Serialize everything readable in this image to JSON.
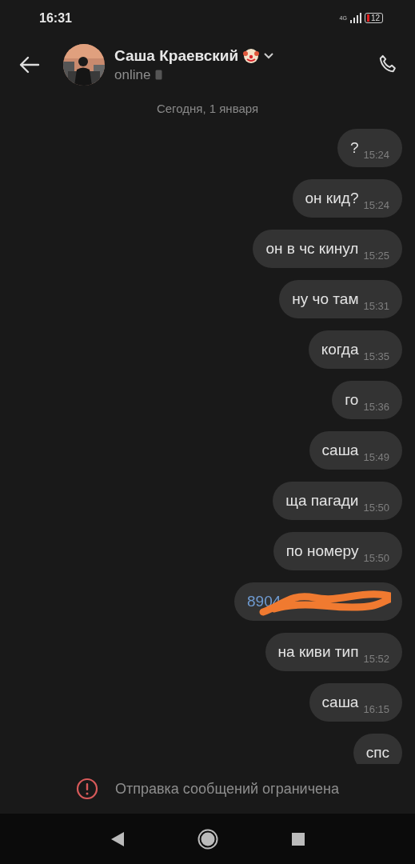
{
  "status_bar": {
    "time": "16:31",
    "network": "4G",
    "battery": "12"
  },
  "header": {
    "contact_name": "Саша Краевский",
    "presence": "online"
  },
  "date_divider": "Сегодня, 1 января",
  "messages": [
    {
      "kind": "text",
      "text": "?",
      "time": "15:24"
    },
    {
      "kind": "text",
      "text": "он кид?",
      "time": "15:24"
    },
    {
      "kind": "text",
      "text": "он в чс кинул",
      "time": "15:25"
    },
    {
      "kind": "text",
      "text": "ну чо там",
      "time": "15:31"
    },
    {
      "kind": "text",
      "text": "когда",
      "time": "15:35"
    },
    {
      "kind": "text",
      "text": "го",
      "time": "15:36"
    },
    {
      "kind": "text",
      "text": "саша",
      "time": "15:49"
    },
    {
      "kind": "text",
      "text": "ща пагади",
      "time": "15:50"
    },
    {
      "kind": "text",
      "text": "по номеру",
      "time": "15:50"
    },
    {
      "kind": "phone",
      "text": "8904"
    },
    {
      "kind": "text",
      "text": "на киви тип",
      "time": "15:52"
    },
    {
      "kind": "text",
      "text": "саша",
      "time": "16:15"
    },
    {
      "kind": "text",
      "text": "спс"
    }
  ],
  "restriction_notice": "Отправка сообщений ограничена"
}
